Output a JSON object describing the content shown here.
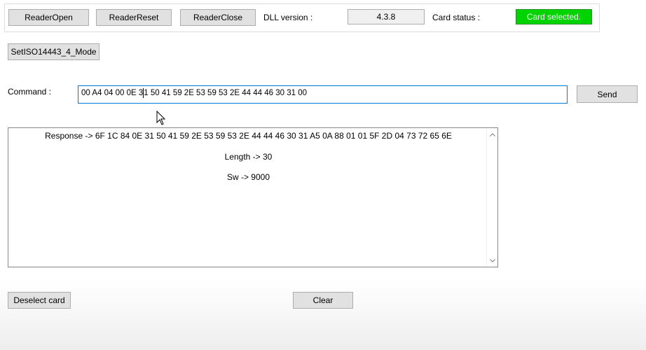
{
  "toolbar": {
    "reader_open_label": "ReaderOpen",
    "reader_reset_label": "ReaderReset",
    "reader_close_label": "ReaderClose",
    "dll_version_label": "DLL version :",
    "dll_version_value": "4.3.8",
    "card_status_label": "Card status :",
    "card_status_value": "Card selected.",
    "card_status_color": "#00d400"
  },
  "mode": {
    "set_mode_label": "SetISO14443_4_Mode"
  },
  "command": {
    "label": "Command :",
    "value_before_caret": "00 A4 04 00 0E 3",
    "value_after_caret": "1 50 41 59 2E 53 59 53 2E 44 44 46 30 31 00",
    "send_label": "Send"
  },
  "response": {
    "lines": [
      "Response -> 6F 1C 84 0E 31 50 41 59 2E 53 59 53 2E 44 44 46 30 31 A5 0A 88 01 01 5F 2D 04 73 72 65 6E",
      "Length -> 30",
      "Sw -> 9000"
    ],
    "scroll_up_icon": "chevron-up-icon",
    "scroll_down_icon": "chevron-down-icon"
  },
  "footer": {
    "deselect_label": "Deselect card",
    "clear_label": "Clear"
  },
  "cursor_icon": "mouse-pointer-icon"
}
